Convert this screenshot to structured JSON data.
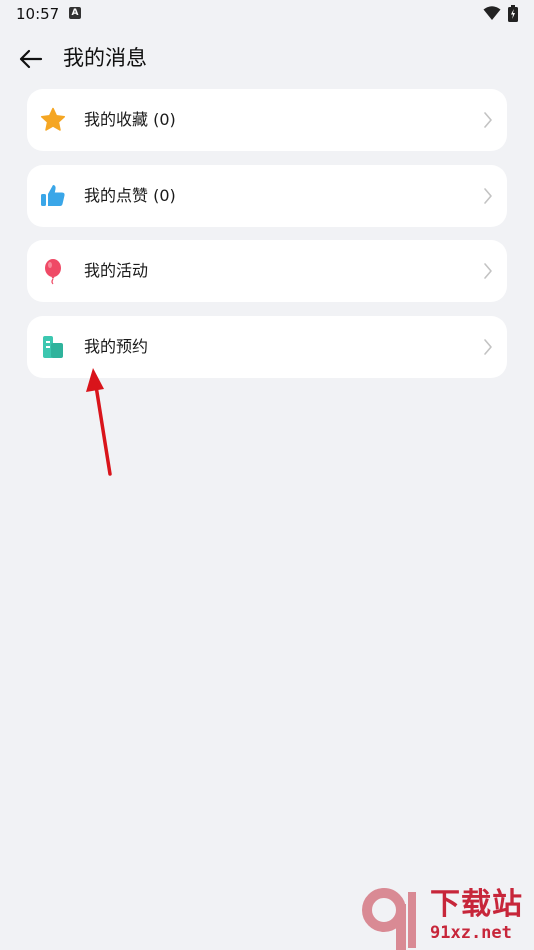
{
  "status_bar": {
    "time": "10:57",
    "notification_icon": "A"
  },
  "header": {
    "title": "我的消息"
  },
  "menu": {
    "items": [
      {
        "label": "我的收藏 (0)",
        "icon": "star-icon",
        "color": "#f5a623"
      },
      {
        "label": "我的点赞 (0)",
        "icon": "thumbs-up-icon",
        "color": "#3aa6e8"
      },
      {
        "label": "我的活动",
        "icon": "balloon-icon",
        "color": "#ef4a66"
      },
      {
        "label": "我的预约",
        "icon": "booking-icon",
        "color": "#3cc7b0"
      }
    ]
  },
  "watermark": {
    "line1": "下载站",
    "line2": "91xz.net",
    "color": "#c7263a"
  }
}
